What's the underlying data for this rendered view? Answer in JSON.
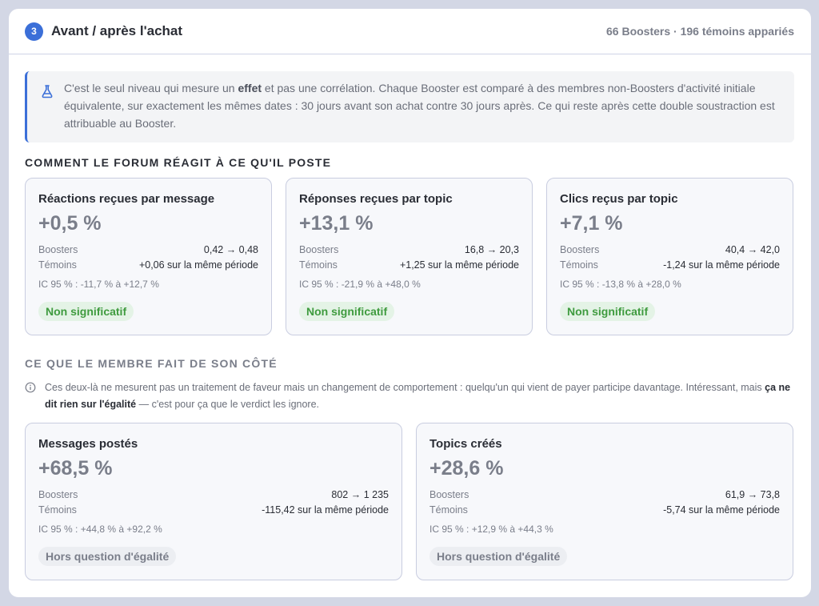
{
  "header": {
    "step": "3",
    "title": "Avant / après l'achat",
    "meta": "66 Boosters · 196 témoins appariés"
  },
  "callout": {
    "icon": "flask-icon",
    "part1": "C'est le seul niveau qui mesure un ",
    "bold": "effet",
    "part2": " et pas une corrélation. Chaque Booster est comparé à des membres non-Boosters d'activité initiale équivalente, sur exactement les mêmes dates : 30 jours avant son achat contre 30 jours après. Ce qui reste après cette double soustraction est attribuable au Booster."
  },
  "section1": {
    "title": "COMMENT LE FORUM RÉAGIT À CE QU'IL POSTE",
    "cards": [
      {
        "title": "Réactions reçues par message",
        "value": "+0,5 %",
        "boosters_label": "Boosters",
        "boosters_value": "0,42 → 0,48",
        "temoins_label": "Témoins",
        "temoins_value": "+0,06 sur la même période",
        "ci": "IC 95 % : -11,7 % à +12,7 %",
        "badge": "Non significatif"
      },
      {
        "title": "Réponses reçues par topic",
        "value": "+13,1 %",
        "boosters_label": "Boosters",
        "boosters_value": "16,8 → 20,3",
        "temoins_label": "Témoins",
        "temoins_value": "+1,25 sur la même période",
        "ci": "IC 95 % : -21,9 % à +48,0 %",
        "badge": "Non significatif"
      },
      {
        "title": "Clics reçus par topic",
        "value": "+7,1 %",
        "boosters_label": "Boosters",
        "boosters_value": "40,4 → 42,0",
        "temoins_label": "Témoins",
        "temoins_value": "-1,24 sur la même période",
        "ci": "IC 95 % : -13,8 % à +28,0 %",
        "badge": "Non significatif"
      }
    ]
  },
  "section2": {
    "title": "CE QUE LE MEMBRE FAIT DE SON CÔTÉ",
    "note_icon": "info-icon",
    "note_part1": "Ces deux-là ne mesurent pas un traitement de faveur mais un changement de comportement : quelqu'un qui vient de payer participe davantage. Intéressant, mais ",
    "note_bold": "ça ne dit rien sur l'égalité",
    "note_part2": " — c'est pour ça que le verdict les ignore.",
    "cards": [
      {
        "title": "Messages postés",
        "value": "+68,5 %",
        "boosters_label": "Boosters",
        "boosters_value": "802 → 1 235",
        "temoins_label": "Témoins",
        "temoins_value": "-115,42 sur la même période",
        "ci": "IC 95 % : +44,8 % à +92,2 %",
        "badge": "Hors question d'égalité"
      },
      {
        "title": "Topics créés",
        "value": "+28,6 %",
        "boosters_label": "Boosters",
        "boosters_value": "61,9 → 73,8",
        "temoins_label": "Témoins",
        "temoins_value": "-5,74 sur la même période",
        "ci": "IC 95 % : +12,9 % à +44,3 %",
        "badge": "Hors question d'égalité"
      }
    ]
  },
  "colors": {
    "accent": "#3b6fd8",
    "success": "#3f9b3f",
    "muted": "#7a7e8a"
  }
}
